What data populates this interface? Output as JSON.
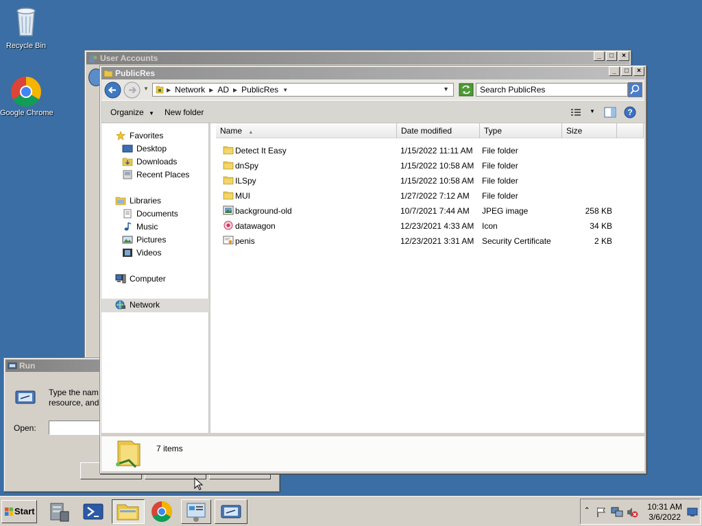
{
  "desktop": {
    "icons": [
      {
        "label": "Recycle Bin",
        "icon": "recycle-bin-icon"
      },
      {
        "label": "Google Chrome",
        "icon": "chrome-icon"
      }
    ]
  },
  "user_accounts_window": {
    "title": "User Accounts"
  },
  "explorer": {
    "title": "PublicRes",
    "breadcrumb": [
      "Network",
      "AD",
      "PublicRes"
    ],
    "search_placeholder": "Search PublicRes",
    "commands": {
      "organize": "Organize",
      "new_folder": "New folder"
    },
    "nav": {
      "favorites": "Favorites",
      "desktop": "Desktop",
      "downloads": "Downloads",
      "recent_places": "Recent Places",
      "libraries": "Libraries",
      "documents": "Documents",
      "music": "Music",
      "pictures": "Pictures",
      "videos": "Videos",
      "computer": "Computer",
      "network": "Network"
    },
    "columns": [
      "Name",
      "Date modified",
      "Type",
      "Size"
    ],
    "files": [
      {
        "name": "Detect It Easy",
        "date": "1/15/2022 11:11 AM",
        "type": "File folder",
        "size": "",
        "icon": "folder-icon"
      },
      {
        "name": "dnSpy",
        "date": "1/15/2022 10:58 AM",
        "type": "File folder",
        "size": "",
        "icon": "folder-icon"
      },
      {
        "name": "ILSpy",
        "date": "1/15/2022 10:58 AM",
        "type": "File folder",
        "size": "",
        "icon": "folder-icon"
      },
      {
        "name": "MUI",
        "date": "1/27/2022 7:12 AM",
        "type": "File folder",
        "size": "",
        "icon": "folder-icon"
      },
      {
        "name": "background-old",
        "date": "10/7/2021 7:44 AM",
        "type": "JPEG image",
        "size": "258 KB",
        "icon": "image-file-icon"
      },
      {
        "name": "datawagon",
        "date": "12/23/2021 4:33 AM",
        "type": "Icon",
        "size": "34 KB",
        "icon": "ico-file-icon"
      },
      {
        "name": "penis",
        "date": "12/23/2021 3:31 AM",
        "type": "Security Certificate",
        "size": "2 KB",
        "icon": "certificate-icon"
      }
    ],
    "status": "7 items"
  },
  "run_dialog": {
    "title": "Run",
    "desc_line1": "Type the nam",
    "desc_line2": "resource, and",
    "open_label": "Open:"
  },
  "taskbar": {
    "start": "Start",
    "clock_time": "10:31 AM",
    "clock_date": "3/6/2022"
  }
}
